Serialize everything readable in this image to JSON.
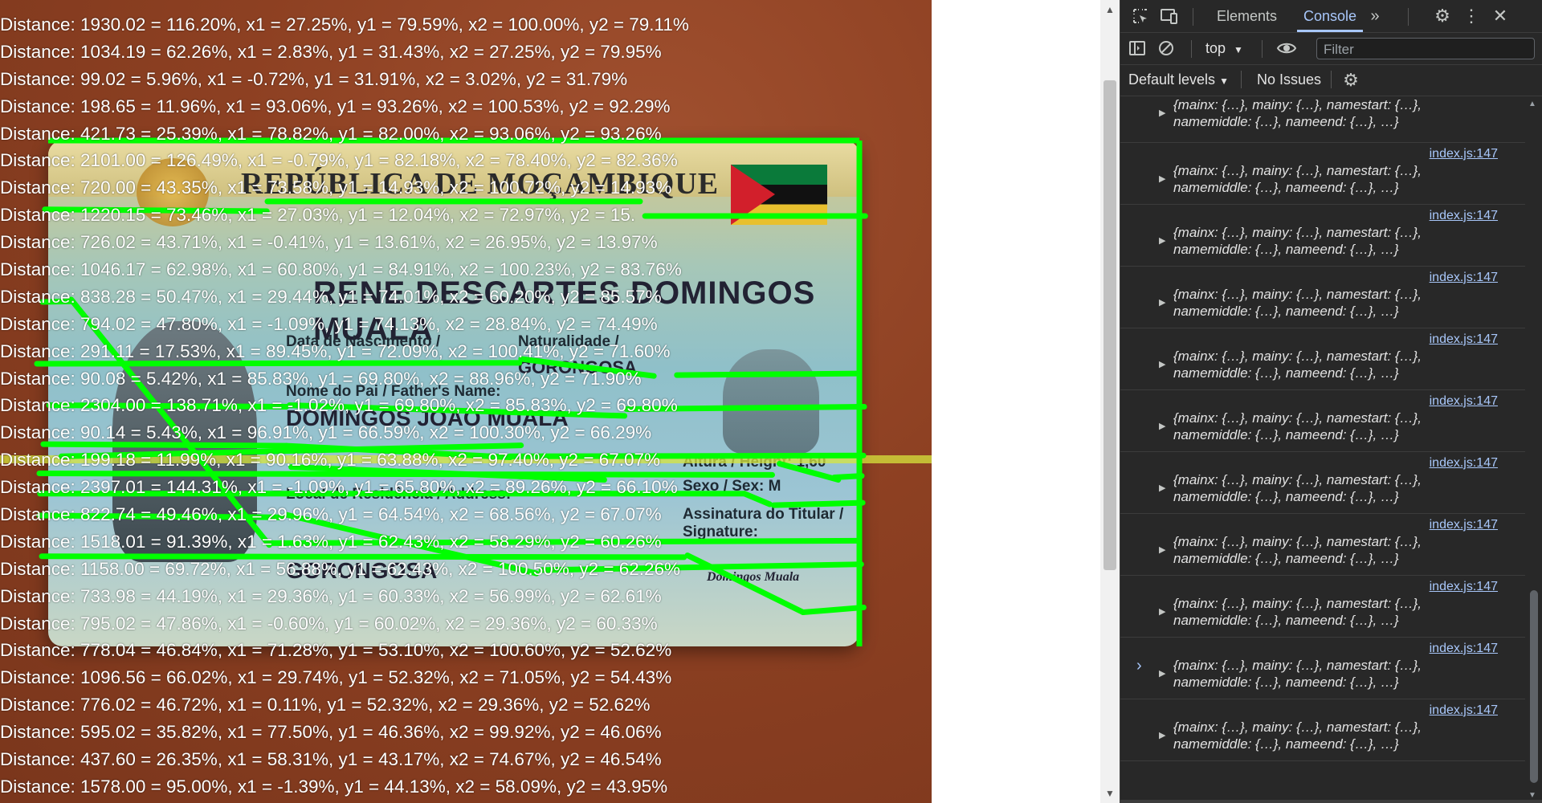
{
  "page": {
    "distances": [
      "Distance: 1930.02 = 116.20%, x1 = 27.25%, y1 = 79.59%, x2 = 100.00%, y2 = 79.11%",
      "Distance: 1034.19 = 62.26%, x1 = 2.83%, y1 = 31.43%, x2 = 27.25%, y2 = 79.95%",
      "Distance: 99.02 = 5.96%, x1 = -0.72%, y1 = 31.91%, x2 = 3.02%, y2 = 31.79%",
      "Distance: 198.65 = 11.96%, x1 = 93.06%, y1 = 93.26%, x2 = 100.53%, y2 = 92.29%",
      "Distance: 421.73 = 25.39%, x1 = 78.82%, y1 = 82.00%, x2 = 93.06%, y2 = 93.26%",
      "Distance: 2101.00 = 126.49%, x1 = -0.79%, y1 = 82.18%, x2 = 78.40%, y2 = 82.36%",
      "Distance: 720.00 = 43.35%, x1 = 73.58%, y1 = 14.93%, x2 = 100.72%, y2 = 14.93%",
      "Distance: 1220.15 = 73.46%, x1 = 27.03%, y1 = 12.04%, x2 = 72.97%, y2 = 15.",
      "Distance: 726.02 = 43.71%, x1 = -0.41%, y1 = 13.61%, x2 = 26.95%, y2 = 13.97%",
      "Distance: 1046.17 = 62.98%, x1 = 60.80%, y1 = 84.91%, x2 = 100.23%, y2 = 83.76%",
      "Distance: 838.28 = 50.47%, x1 = 29.44%, y1 = 74.01%, x2 = 60.20%, y2 = 85.57%",
      "Distance: 794.02 = 47.80%, x1 = -1.09%, y1 = 74.13%, x2 = 28.84%, y2 = 74.49%",
      "Distance: 291.11 = 17.53%, x1 = 89.45%, y1 = 72.09%, x2 = 100.41%, y2 = 71.60%",
      "Distance: 90.08 = 5.42%, x1 = 85.83%, y1 = 69.80%, x2 = 88.96%, y2 = 71.90%",
      "Distance: 2304.00 = 138.71%, x1 = -1.02%, y1 = 69.80%, x2 = 85.83%, y2 = 69.80%",
      "Distance: 90.14 = 5.43%, x1 = 96.91%, y1 = 66.59%, x2 = 100.30%, y2 = 66.29%",
      "Distance: 199.18 = 11.99%, x1 = 90.16%, y1 = 63.88%, x2 = 97.40%, y2 = 67.07%",
      "Distance: 2397.01 = 144.31%, x1 = -1.09%, y1 = 65.80%, x2 = 89.26%, y2 = 66.10%",
      "Distance: 822.74 = 49.46%, x1 = 29.96%, y1 = 64.54%, x2 = 68.56%, y2 = 67.07%",
      "Distance: 1518.01 = 91.39%, x1 = 1.63%, y1 = 62.43%, x2 = 58.29%, y2 = 60.26%",
      "Distance: 1158.00 = 69.72%, x1 = 56.88%, y1 = 62.43%, x2 = 100.50%, y2 = 62.26%",
      "Distance: 733.98 = 44.19%, x1 = 29.36%, y1 = 60.33%, x2 = 56.99%, y2 = 62.61%",
      "Distance: 795.02 = 47.86%, x1 = -0.60%, y1 = 60.02%, x2 = 29.36%, y2 = 60.33%",
      "Distance: 778.04 = 46.84%, x1 = 71.28%, y1 = 53.10%, x2 = 100.60%, y2 = 52.62%",
      "Distance: 1096.56 = 66.02%, x1 = 29.74%, y1 = 52.32%, x2 = 71.05%, y2 = 54.43%",
      "Distance: 776.02 = 46.72%, x1 = 0.11%, y1 = 52.32%, x2 = 29.36%, y2 = 52.62%",
      "Distance: 595.02 = 35.82%, x1 = 77.50%, y1 = 46.36%, x2 = 99.92%, y2 = 46.06%",
      "Distance: 437.60 = 26.35%, x1 = 58.31%, y1 = 43.17%, x2 = 74.67%, y2 = 46.54%",
      "Distance: 1578.00 = 95.00%, x1 = -1.39%, y1 = 44.13%, x2 = 58.09%, y2 = 43.95%"
    ],
    "card": {
      "title": "REPÚBLICA DE MOÇAMBIQUE",
      "name": "RENE DESCARTES DOMINGOS MUALA",
      "birth_label": "Data de Nascimento /",
      "birth_place_label": "Naturalidade /",
      "birth_place_value": "GORONGOSA",
      "father_label": "Nome do Pai / Father's Name:",
      "father_value": "DOMINGOS JOAO MUALA",
      "residence_label": "Local de Residência / Address:",
      "residence_value": "GORONGOSA",
      "height_label": "Altura / Height: 1,60",
      "sex_label": "Sexo / Sex: M",
      "signature_label": "Assinatura do Titular / Signature:",
      "signature_value": "Domingos Muala"
    },
    "overlay_color": "#00ff00",
    "photo_color": "#8b3f22"
  },
  "devtools": {
    "tabs": [
      "Elements",
      "Console"
    ],
    "active_tab": "Console",
    "more_tabs_icon": "chevron-double-right-icon",
    "context": "top",
    "filter_placeholder": "Filter",
    "levels": "Default levels",
    "issues": "No Issues",
    "log_source": "index.js:147",
    "log_line1": "{mainx: {…}, mainy: {…}, namestart: {…},",
    "log_line2": "namemiddle: {…}, nameend: {…}, …}",
    "prompt": "›",
    "accent_color": "#a8c7fa"
  }
}
